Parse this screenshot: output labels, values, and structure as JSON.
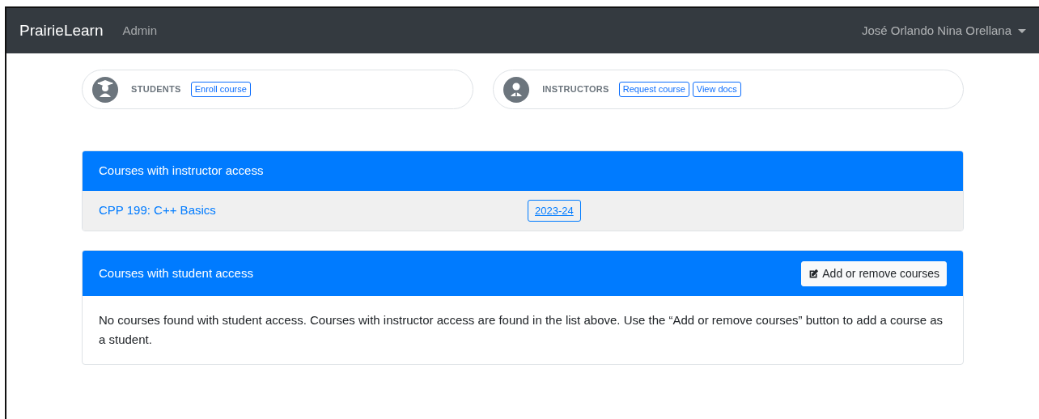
{
  "navbar": {
    "brand": "PrairieLearn",
    "links": [
      {
        "label": "Admin",
        "selected": false
      }
    ],
    "user": "José Orlando Nina Orellana"
  },
  "roles": [
    {
      "kind": "student",
      "label": "STUDENTS",
      "actions": [
        "Enroll course"
      ]
    },
    {
      "kind": "instructor",
      "label": "INSTRUCTORS",
      "actions": [
        "Request course",
        "View docs"
      ]
    }
  ],
  "instructor_courses": {
    "title": "Courses with instructor access",
    "rows": [
      {
        "name": "CPP 199: C++ Basics",
        "terms": [
          "2023-24"
        ]
      }
    ]
  },
  "student_courses": {
    "title": "Courses with student access",
    "button": "Add or remove courses",
    "message": "No courses found with student access. Courses with instructor access are found in the list above. Use the “Add or remove courses” button to add a course as a student."
  }
}
